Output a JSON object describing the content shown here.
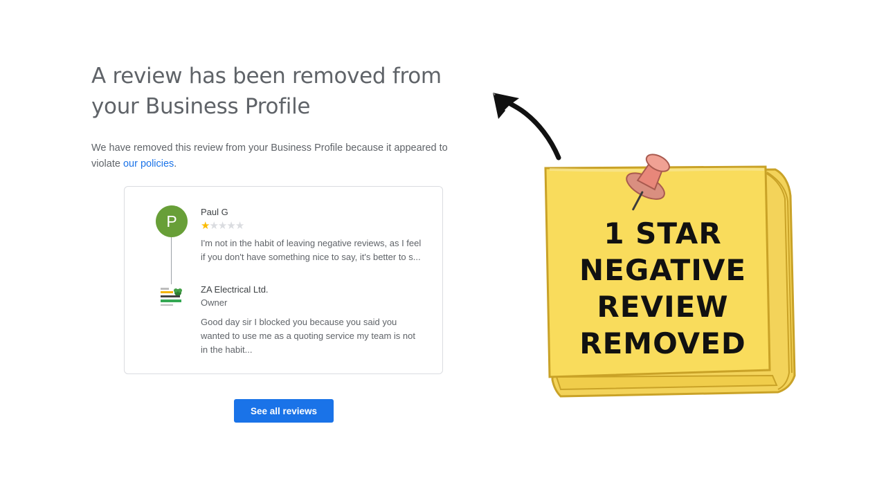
{
  "heading": {
    "title": "A review has been removed from your Business Profile"
  },
  "description": {
    "text": "We have removed this review from your Business Profile because it appeared to violate ",
    "link": "our policies",
    "end": "."
  },
  "review": {
    "avatar_letter": "P",
    "avatar_color": "#689f38",
    "reviewer_name": "Paul G",
    "rating": 1,
    "rating_max": 5,
    "text": "I'm not in the habit of leaving negative reviews, as I feel if you don't have something nice to say, it's better to s..."
  },
  "reply": {
    "owner_name": "ZA Electrical Ltd.",
    "owner_role": "Owner",
    "text": "Good day sir I blocked you because you said you wanted to use me as a quoting service my team is not in the habit..."
  },
  "actions": {
    "see_all_label": "See all reviews"
  },
  "sticky_note": {
    "line1": "1 STAR",
    "line2": "NEGATIVE",
    "line3": "REVIEW",
    "line4": "REMOVED",
    "fill_color": "#f9dc5c",
    "pin_color": "#e8877a"
  },
  "colors": {
    "accent": "#1a73e8",
    "star": "#fbbc04"
  }
}
